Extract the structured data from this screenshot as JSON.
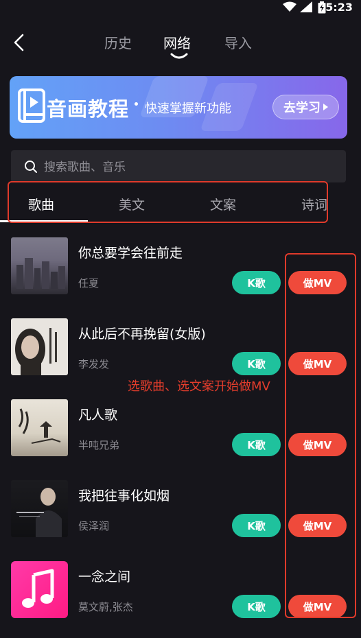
{
  "status_bar": {
    "time": "5:23",
    "icons": [
      "wifi-icon",
      "signal-icon",
      "battery-charging-icon"
    ]
  },
  "header": {
    "back_icon": "back-arrow-icon",
    "tabs": [
      {
        "label": "历史",
        "active": false
      },
      {
        "label": "网络",
        "active": true
      },
      {
        "label": "导入",
        "active": false
      }
    ]
  },
  "banner": {
    "icon": "book-icon",
    "title": "音画教程",
    "subtitle": "快速掌握新功能",
    "button_label": "去学习",
    "gradient": [
      "#63a2f7",
      "#8767ea"
    ]
  },
  "search": {
    "placeholder": "搜索歌曲、音乐",
    "value": ""
  },
  "categories": [
    {
      "label": "歌曲",
      "active": true
    },
    {
      "label": "美文",
      "active": false
    },
    {
      "label": "文案",
      "active": false
    },
    {
      "label": "诗词",
      "active": false
    }
  ],
  "songs": [
    {
      "title": "你总要学会往前走",
      "artist": "任夏",
      "k_label": "K歌",
      "mv_label": "做MV"
    },
    {
      "title": "从此后不再挽留(女版)",
      "artist": "李发发",
      "k_label": "K歌",
      "mv_label": "做MV"
    },
    {
      "title": "凡人歌",
      "artist": "半吨兄弟",
      "k_label": "K歌",
      "mv_label": "做MV"
    },
    {
      "title": "我把往事化如烟",
      "artist": "侯泽润",
      "k_label": "K歌",
      "mv_label": "做MV"
    },
    {
      "title": "一念之间",
      "artist": "莫文蔚,张杰",
      "k_label": "K歌",
      "mv_label": "做MV"
    }
  ],
  "annotation": "选歌曲、选文案开始做MV",
  "colors": {
    "background": "#16151b",
    "k_button": "#1fc29d",
    "mv_button": "#ef4a3b",
    "highlight": "#e03a2b"
  }
}
